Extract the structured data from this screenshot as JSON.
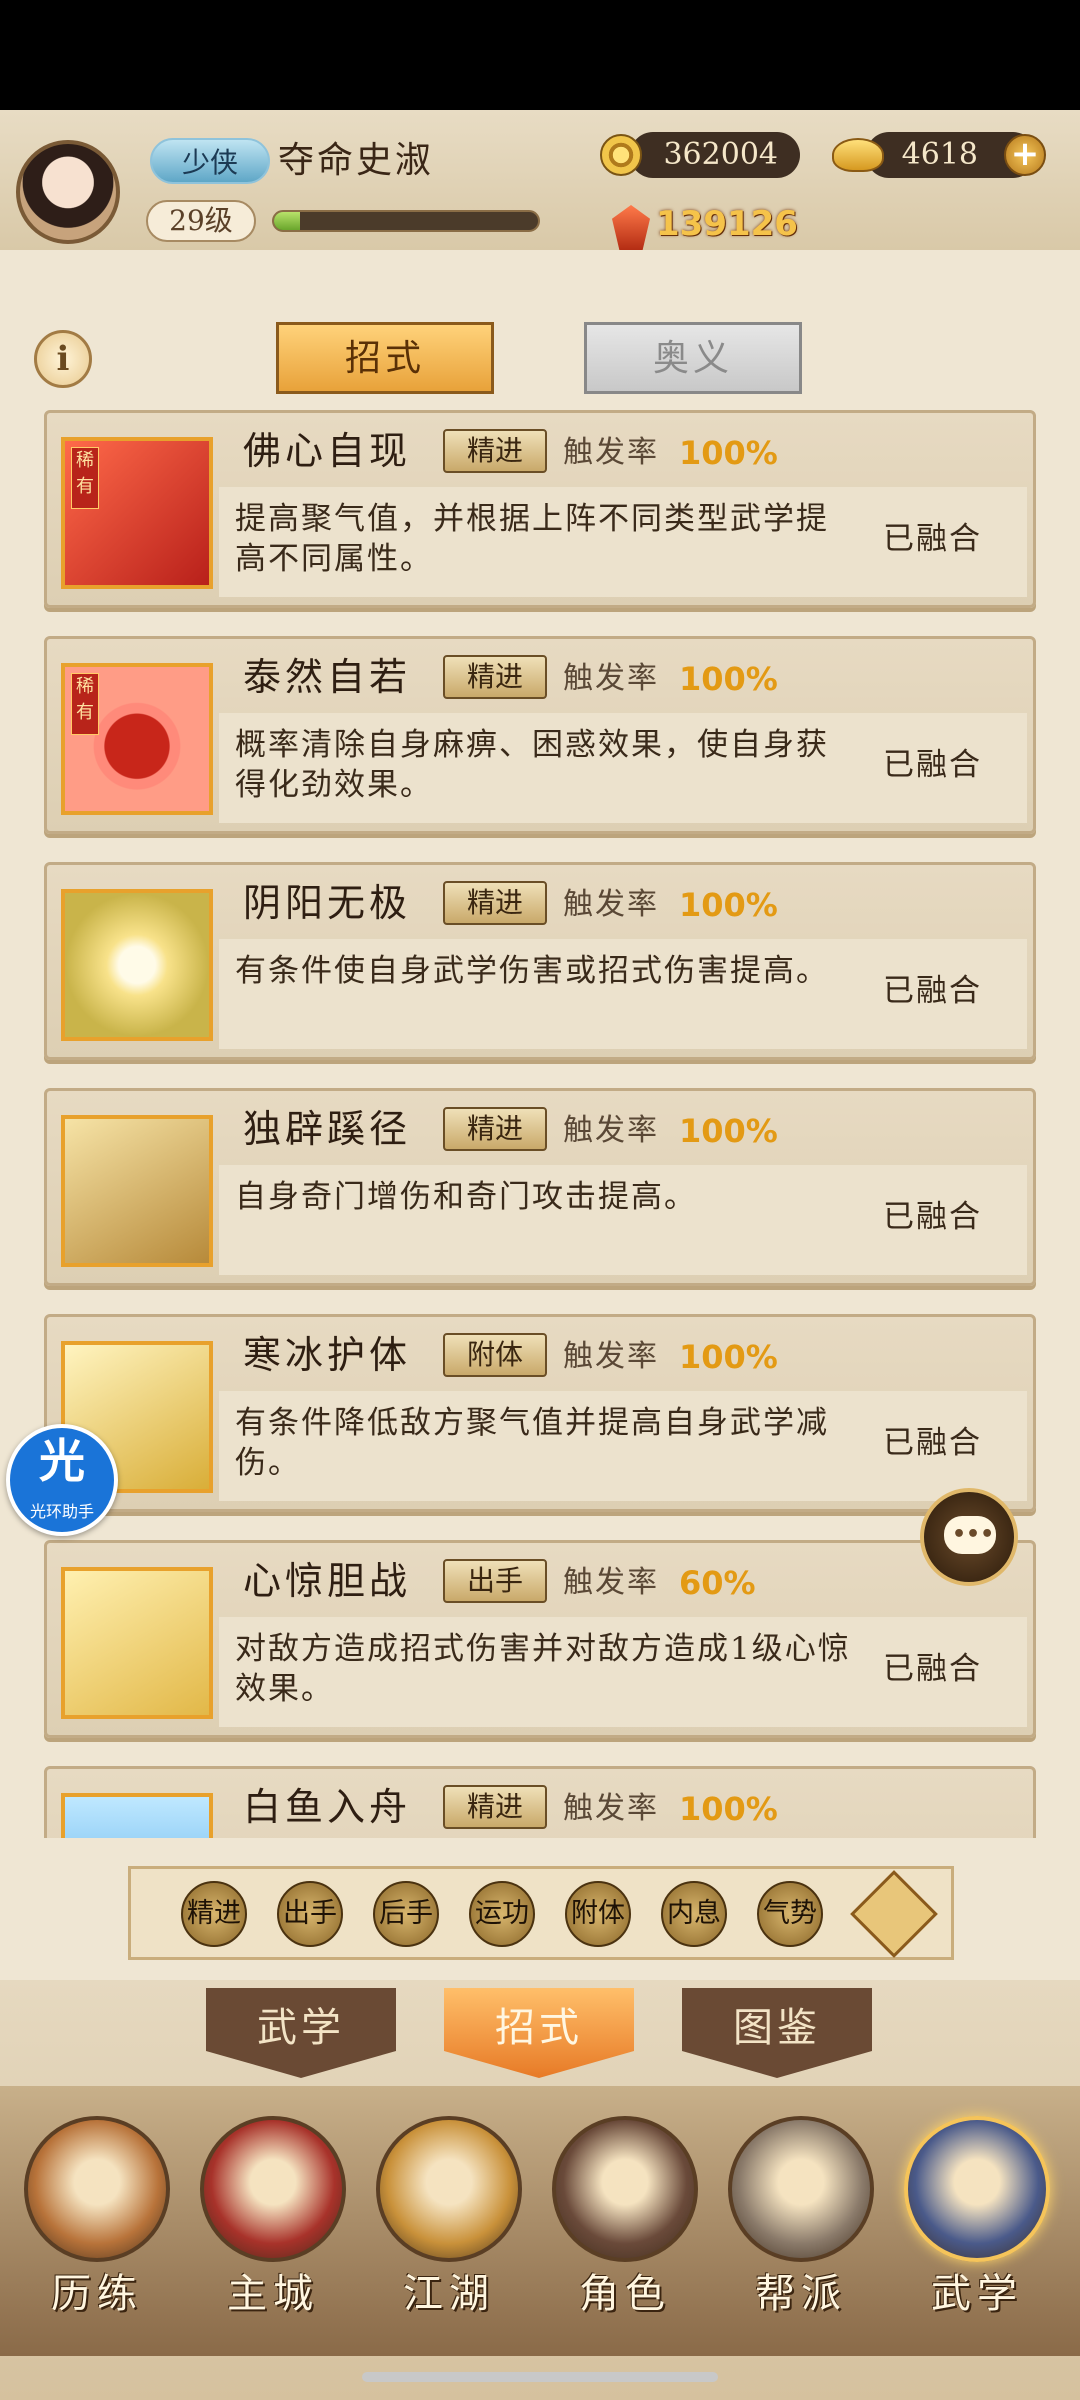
{
  "player": {
    "rank": "少侠",
    "name": "夺命史淑",
    "level": "29级",
    "exp_fraction": 0.1
  },
  "currency": {
    "coins": "362004",
    "ingots": "4618",
    "plus_symbol": "+"
  },
  "power": "139126",
  "info_symbol": "i",
  "subtabs": [
    {
      "label": "招式",
      "active": true
    },
    {
      "label": "奥义",
      "active": false
    }
  ],
  "rate_label": "触发率",
  "rare_text": "稀有",
  "skills": [
    {
      "title": "佛心自现",
      "tag": "精进",
      "rate": "100%",
      "desc": "提高聚气值，并根据上阵不同类型武学提高不同属性。",
      "status": "已融合",
      "icon": "praying-hands-icon",
      "rare": true
    },
    {
      "title": "泰然自若",
      "tag": "精进",
      "rate": "100%",
      "desc": "概率清除自身麻痹、困惑效果，使自身获得化劲效果。",
      "status": "已融合",
      "icon": "red-ring-icon",
      "rare": true
    },
    {
      "title": "阴阳无极",
      "tag": "精进",
      "rate": "100%",
      "desc": "有条件使自身武学伤害或招式伤害提高。",
      "status": "已融合",
      "icon": "sun-swirl-icon",
      "rare": false
    },
    {
      "title": "独辟蹊径",
      "tag": "精进",
      "rate": "100%",
      "desc": "自身奇门增伤和奇门攻击提高。",
      "status": "已融合",
      "icon": "running-figure-icon",
      "rare": false
    },
    {
      "title": "寒冰护体",
      "tag": "附体",
      "rate": "100%",
      "desc": "有条件降低敌方聚气值并提高自身武学减伤。",
      "status": "已融合",
      "icon": "ice-warrior-icon",
      "rare": false
    },
    {
      "title": "心惊胆战",
      "tag": "出手",
      "rate": "60%",
      "desc": "对敌方造成招式伤害并对敌方造成1级心惊效果。",
      "status": "已融合",
      "icon": "fear-figure-icon",
      "rare": false
    },
    {
      "title": "白鱼入舟",
      "tag": "精进",
      "rate": "100%",
      "desc": "",
      "status": "",
      "icon": "fish-boat-icon",
      "rare": false
    }
  ],
  "filters": [
    "精进",
    "出手",
    "后手",
    "运功",
    "附体",
    "内息",
    "气势"
  ],
  "bottom_tabs": [
    {
      "label": "武学",
      "active": false
    },
    {
      "label": "招式",
      "active": true
    },
    {
      "label": "图鉴",
      "active": false
    }
  ],
  "nav": [
    {
      "label": "历练",
      "icon": "training-icon",
      "active": false,
      "color": "#b8733a"
    },
    {
      "label": "主城",
      "icon": "city-gate-icon",
      "active": false,
      "color": "#a8322a"
    },
    {
      "label": "江湖",
      "icon": "jianghu-sword-icon",
      "active": false,
      "color": "#c9913a"
    },
    {
      "label": "角色",
      "icon": "character-hat-icon",
      "active": false,
      "color": "#6a4a3a"
    },
    {
      "label": "帮派",
      "icon": "guild-emblem-icon",
      "active": false,
      "color": "#8a7a6a"
    },
    {
      "label": "武学",
      "icon": "scroll-books-icon",
      "active": true,
      "color": "#4a5a8a"
    }
  ],
  "floating": {
    "helper_glyph": "光",
    "helper_label": "光环助手",
    "chat_dots": "•••"
  }
}
